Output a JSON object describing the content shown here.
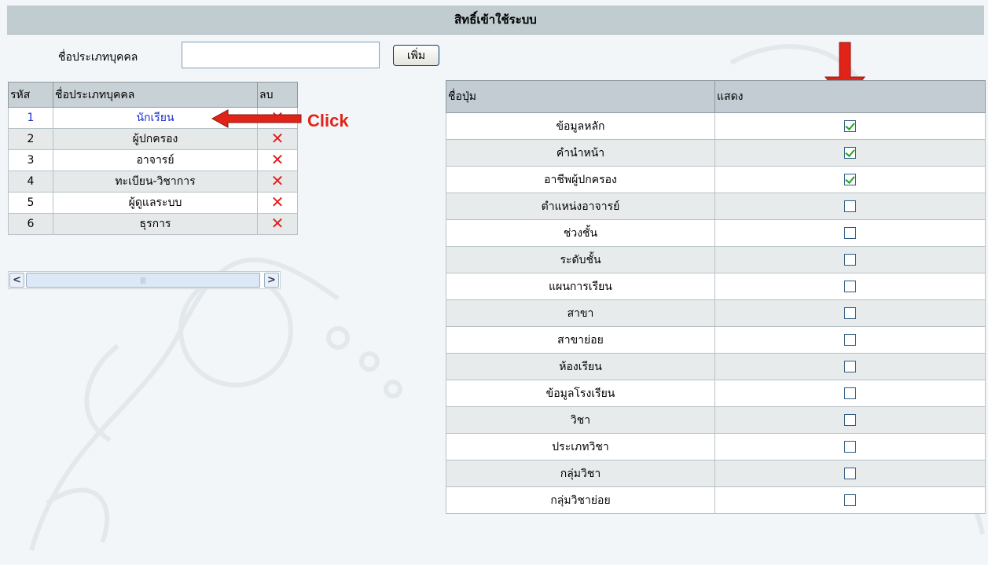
{
  "header": {
    "title": "สิทธิ์เข้าใช้ระบบ"
  },
  "form": {
    "name_label": "ชื่อประเภทบุคคล",
    "name_value": "",
    "add_label": "เพิ่ม"
  },
  "left_table": {
    "columns": [
      "รหัส",
      "ชื่อประเภทบุคคล",
      "ลบ"
    ],
    "rows": [
      {
        "id": "1",
        "name": "นักเรียน",
        "delete_icon": "x-icon"
      },
      {
        "id": "2",
        "name": "ผู้ปกครอง",
        "delete_icon": "x-icon"
      },
      {
        "id": "3",
        "name": "อาจารย์",
        "delete_icon": "x-icon"
      },
      {
        "id": "4",
        "name": "ทะเบียน-วิชาการ",
        "delete_icon": "x-icon"
      },
      {
        "id": "5",
        "name": "ผู้ดูแลระบบ",
        "delete_icon": "x-icon"
      },
      {
        "id": "6",
        "name": "ธุรการ",
        "delete_icon": "x-icon"
      }
    ],
    "selected_row": "1"
  },
  "annotation": {
    "click_text": "Click",
    "arrow_color": "#e2231a"
  },
  "right_table": {
    "columns": [
      "ชื่อปุ่ม",
      "แสดง"
    ],
    "rows": [
      {
        "name": "ข้อมูลหลัก",
        "checked": true
      },
      {
        "name": "คำนำหน้า",
        "checked": true
      },
      {
        "name": "อาชีพผู้ปกครอง",
        "checked": true
      },
      {
        "name": "ตำแหน่งอาจารย์",
        "checked": false
      },
      {
        "name": "ช่วงชั้น",
        "checked": false
      },
      {
        "name": "ระดับชั้น",
        "checked": false
      },
      {
        "name": "แผนการเรียน",
        "checked": false
      },
      {
        "name": "สาขา",
        "checked": false
      },
      {
        "name": "สาขาย่อย",
        "checked": false
      },
      {
        "name": "ห้องเรียน",
        "checked": false
      },
      {
        "name": "ข้อมูลโรงเรียน",
        "checked": false
      },
      {
        "name": "วิชา",
        "checked": false
      },
      {
        "name": "ประเภทวิชา",
        "checked": false
      },
      {
        "name": "กลุ่มวิชา",
        "checked": false
      },
      {
        "name": "กลุ่มวิชาย่อย",
        "checked": false
      }
    ]
  }
}
